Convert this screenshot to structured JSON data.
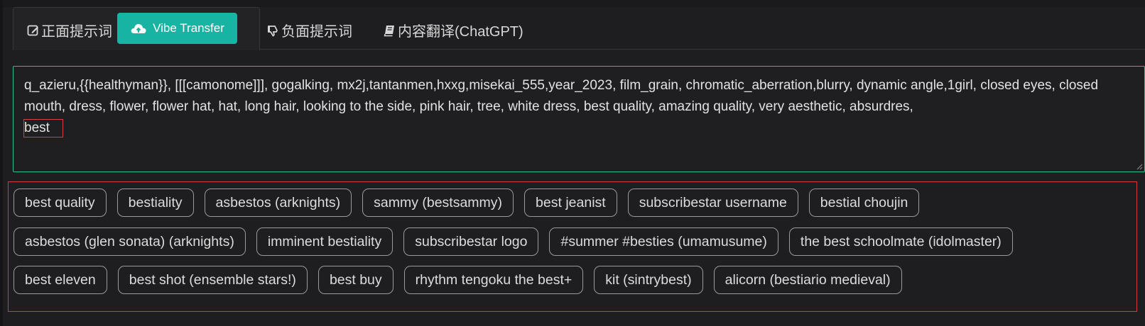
{
  "tabs": [
    {
      "label": "正面提示词",
      "icon": "edit-icon"
    },
    {
      "label": "负面提示词",
      "icon": "thumbs-down-icon"
    },
    {
      "label": "内容翻译(ChatGPT)",
      "icon": "book-icon"
    }
  ],
  "vibe_button": {
    "label": "Vibe Transfer",
    "icon": "cloud-upload-icon"
  },
  "prompt": {
    "text": "q_azieru,{{healthyman}}, [[[camonome]]], gogalking, mx2j,tantanmen,hxxg,misekai_555,year_2023, film_grain, chromatic_aberration,blurry, dynamic angle,1girl, closed eyes, closed mouth, dress, flower, flower hat, hat, long hair, looking to the side, pink hair, tree, white dress, best quality, amazing quality, very aesthetic, absurdres,",
    "current_word": "best"
  },
  "suggestions": [
    [
      "best quality",
      "bestiality",
      "asbestos (arknights)",
      "sammy (bestsammy)",
      "best jeanist",
      "subscribestar username",
      "bestial choujin"
    ],
    [
      "asbestos (glen sonata) (arknights)",
      "imminent bestiality",
      "subscribestar logo",
      "#summer #besties (umamusume)",
      "the best schoolmate (idolmaster)"
    ],
    [
      "best eleven",
      "best shot (ensemble stars!)",
      "best buy",
      "rhythm tengoku the best+",
      "kit (sintrybest)",
      "alicorn (bestiario medieval)"
    ]
  ],
  "colors": {
    "accent": "#17b3a3",
    "textarea_border": "#2fbf8f",
    "highlight_border": "#d43a3a"
  }
}
